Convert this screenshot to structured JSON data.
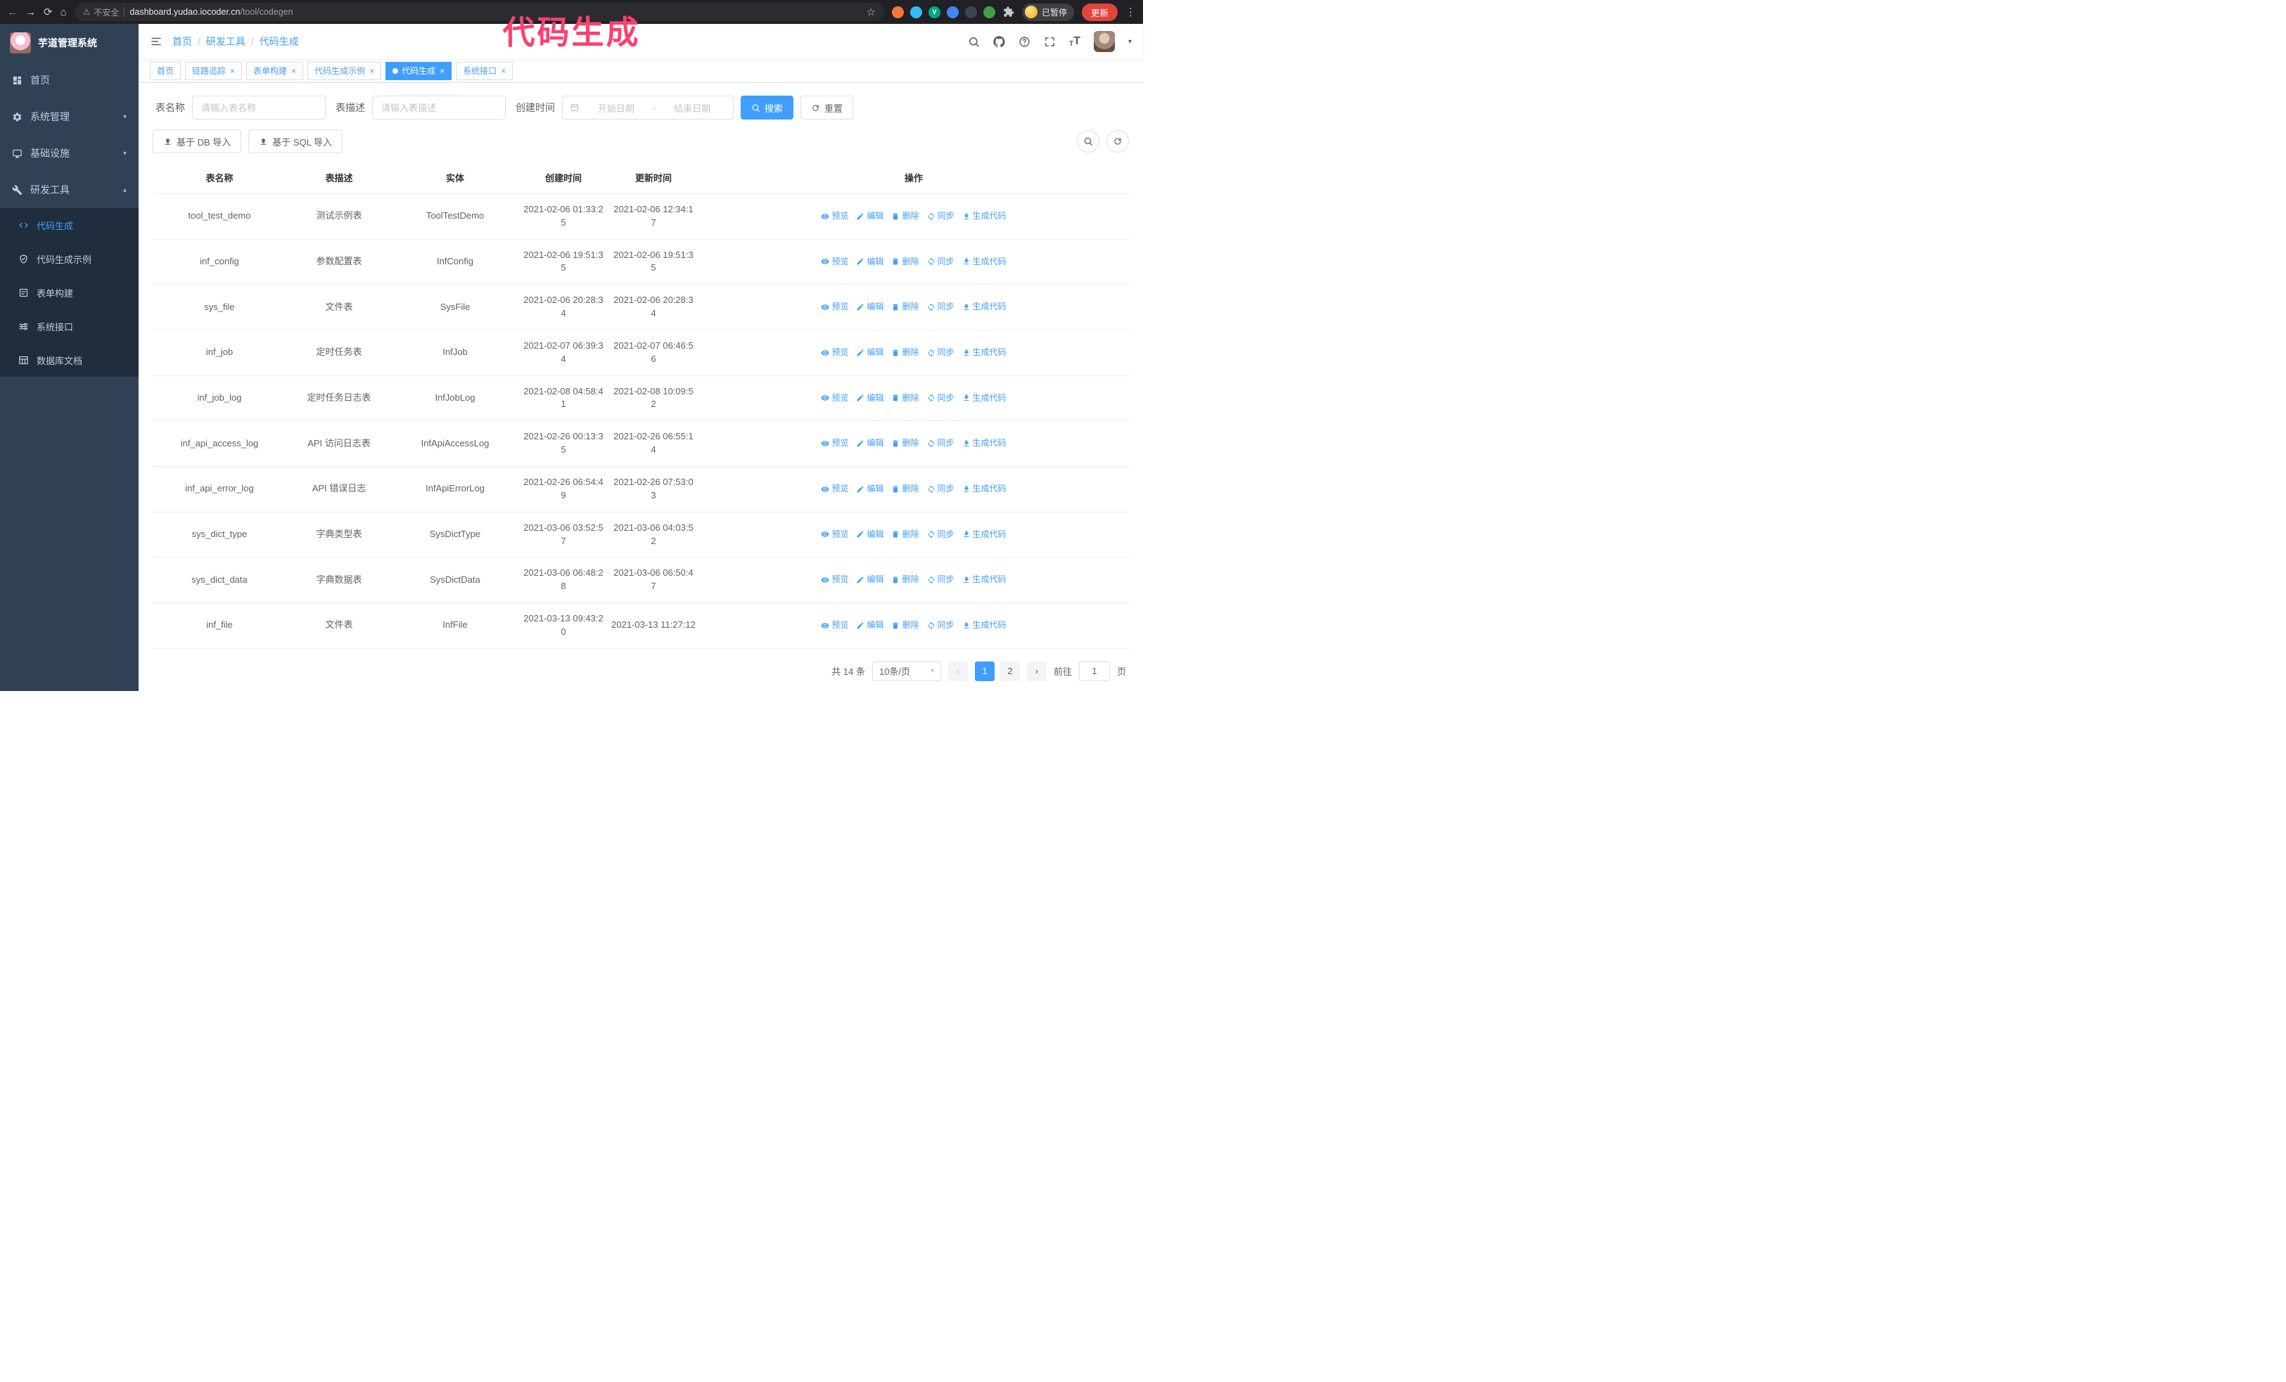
{
  "annotation": {
    "text": "代码生成"
  },
  "colors": {
    "accent": "#409eff",
    "annotation_pink": "#fb4070",
    "sidebar_bg": "#304156",
    "submenu_bg": "#1f2d3d",
    "update_button_red": "#e2443b"
  },
  "glyphs": {
    "back": "←",
    "forward": "→",
    "reload": "⟳",
    "home": "⌂",
    "warning": "⚠",
    "star": "☆",
    "kebab": "⋮",
    "chevron_down": "▾",
    "chevron_up": "▴",
    "caret_down": "▾",
    "prev": "‹",
    "next": "›",
    "close": "×",
    "slash": "/",
    "font_size": "T"
  },
  "browser": {
    "security_label": "不安全",
    "url_domain": "dashboard.yudao.iocoder.cn",
    "url_path": "/tool/codegen",
    "paused_badge": "已暂停",
    "update_button": "更新",
    "extensions": [
      {
        "name": "orange-extension-icon",
        "color": "#f4763b",
        "letter": ""
      },
      {
        "name": "blue-drop-extension-icon",
        "color": "#35baf6",
        "letter": ""
      },
      {
        "name": "green-v-extension-icon",
        "color": "#00a884",
        "letter": "V"
      },
      {
        "name": "people-extension-icon",
        "color": "#4285f4",
        "letter": ""
      },
      {
        "name": "dark-extension-icon",
        "color": "#37474f",
        "letter": ""
      },
      {
        "name": "leaf-extension-icon",
        "color": "#43a047",
        "letter": ""
      }
    ]
  },
  "sidebar": {
    "app_title": "芋道管理系统",
    "items": [
      {
        "label": "首页",
        "icon": "dashboard-icon"
      },
      {
        "label": "系统管理",
        "icon": "gear-icon",
        "chevron": "down"
      },
      {
        "label": "基础设施",
        "icon": "monitor-icon",
        "chevron": "down"
      },
      {
        "label": "研发工具",
        "icon": "wrench-icon",
        "chevron": "up",
        "expanded": true,
        "children": [
          {
            "label": "代码生成",
            "icon": "code-icon",
            "active": true
          },
          {
            "label": "代码生成示例",
            "icon": "shield-icon"
          },
          {
            "label": "表单构建",
            "icon": "form-icon"
          },
          {
            "label": "系统接口",
            "icon": "sliders-icon"
          },
          {
            "label": "数据库文档",
            "icon": "table-icon"
          }
        ]
      }
    ]
  },
  "header": {
    "breadcrumb": [
      "首页",
      "研发工具",
      "代码生成"
    ]
  },
  "tabs": [
    {
      "label": "首页",
      "closable": false
    },
    {
      "label": "链路追踪",
      "closable": true
    },
    {
      "label": "表单构建",
      "closable": true
    },
    {
      "label": "代码生成示例",
      "closable": true
    },
    {
      "label": "代码生成",
      "closable": true,
      "active": true
    },
    {
      "label": "系统接口",
      "closable": true
    }
  ],
  "filters": {
    "name_label": "表名称",
    "name_placeholder": "请输入表名称",
    "desc_label": "表描述",
    "desc_placeholder": "请输入表描述",
    "time_label": "创建时间",
    "start_placeholder": "开始日期",
    "range_separator": "-",
    "end_placeholder": "结束日期",
    "search_button": "搜索",
    "reset_button": "重置"
  },
  "toolbar": {
    "import_db": "基于 DB 导入",
    "import_sql": "基于 SQL 导入"
  },
  "table": {
    "columns": [
      "表名称",
      "表描述",
      "实体",
      "创建时间",
      "更新时间",
      "操作"
    ],
    "ops": [
      {
        "label": "预览",
        "icon": "eye-icon"
      },
      {
        "label": "编辑",
        "icon": "edit-icon"
      },
      {
        "label": "删除",
        "icon": "trash-icon"
      },
      {
        "label": "同步",
        "icon": "sync-icon"
      },
      {
        "label": "生成代码",
        "icon": "download-icon"
      }
    ],
    "rows": [
      {
        "name": "tool_test_demo",
        "desc": "测试示例表",
        "entity": "ToolTestDemo",
        "created": "2021-02-06 01:33:25",
        "updated": "2021-02-06 12:34:17"
      },
      {
        "name": "inf_config",
        "desc": "参数配置表",
        "entity": "InfConfig",
        "created": "2021-02-06 19:51:35",
        "updated": "2021-02-06 19:51:35"
      },
      {
        "name": "sys_file",
        "desc": "文件表",
        "entity": "SysFile",
        "created": "2021-02-06 20:28:34",
        "updated": "2021-02-06 20:28:34"
      },
      {
        "name": "inf_job",
        "desc": "定时任务表",
        "entity": "InfJob",
        "created": "2021-02-07 06:39:34",
        "updated": "2021-02-07 06:46:56"
      },
      {
        "name": "inf_job_log",
        "desc": "定时任务日志表",
        "entity": "InfJobLog",
        "created": "2021-02-08 04:58:41",
        "updated": "2021-02-08 10:09:52"
      },
      {
        "name": "inf_api_access_log",
        "desc": "API 访问日志表",
        "entity": "InfApiAccessLog",
        "created": "2021-02-26 00:13:35",
        "updated": "2021-02-26 06:55:14"
      },
      {
        "name": "inf_api_error_log",
        "desc": "API 错误日志",
        "entity": "InfApiErrorLog",
        "created": "2021-02-26 06:54:49",
        "updated": "2021-02-26 07:53:03"
      },
      {
        "name": "sys_dict_type",
        "desc": "字典类型表",
        "entity": "SysDictType",
        "created": "2021-03-06 03:52:57",
        "updated": "2021-03-06 04:03:52"
      },
      {
        "name": "sys_dict_data",
        "desc": "字典数据表",
        "entity": "SysDictData",
        "created": "2021-03-06 06:48:28",
        "updated": "2021-03-06 06:50:47"
      },
      {
        "name": "inf_file",
        "desc": "文件表",
        "entity": "InfFile",
        "created": "2021-03-13 09:43:20",
        "updated": "2021-03-13 11:27:12"
      }
    ]
  },
  "pagination": {
    "total": "共 14 条",
    "page_size": "10条/页",
    "pages": [
      {
        "label": "1",
        "active": true
      },
      {
        "label": "2"
      }
    ],
    "goto_label": "前往",
    "goto_value": "1",
    "page_suffix": "页"
  }
}
